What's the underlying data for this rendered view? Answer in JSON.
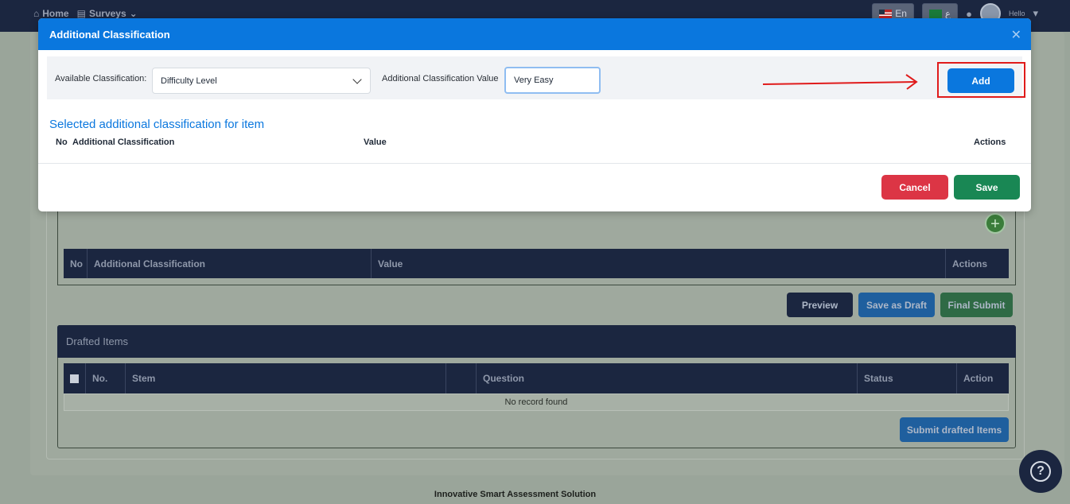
{
  "nav": {
    "home": "Home",
    "surveys": "Surveys",
    "lang": "En",
    "lang2": "ع",
    "hello": "Hello"
  },
  "background": {
    "classification_table": {
      "columns": [
        "No",
        "Additional Classification",
        "Value",
        "Actions"
      ]
    },
    "actions": {
      "preview": "Preview",
      "save_draft": "Save as Draft",
      "final_submit": "Final Submit"
    },
    "drafted": {
      "title": "Drafted Items",
      "columns": [
        "",
        "No.",
        "Stem",
        "",
        "Question",
        "Status",
        "Action"
      ],
      "empty": "No record found",
      "submit": "Submit drafted Items"
    },
    "footer": "Innovative Smart Assessment Solution"
  },
  "modal": {
    "title": "Additional Classification",
    "available_label": "Available Classification:",
    "available_value": "Difficulty Level",
    "value_label": "Additional Classification Value",
    "value_input": "Very Easy",
    "add": "Add",
    "selected_title": "Selected additional classification for item",
    "columns": [
      "No",
      "Additional Classification",
      "Value",
      "Actions"
    ],
    "cancel": "Cancel",
    "save": "Save"
  },
  "colors": {
    "primary": "#0a77de",
    "navy": "#1b2640",
    "danger": "#dc3545",
    "success": "#198754",
    "highlight": "#e01b1b"
  }
}
